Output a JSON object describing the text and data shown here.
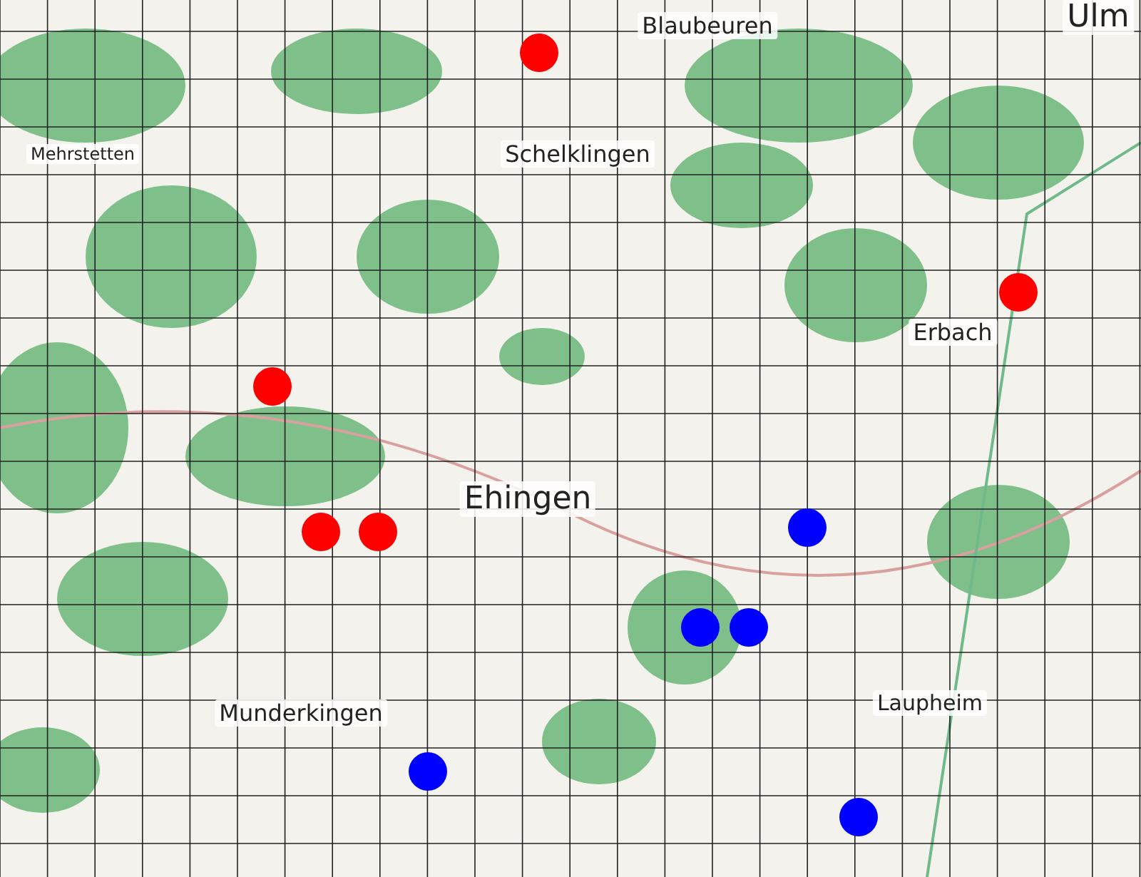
{
  "map": {
    "places": [
      {
        "name": "Blaubeuren"
      },
      {
        "name": "Ulm"
      },
      {
        "name": "Mehrstetten"
      },
      {
        "name": "Schelklingen"
      },
      {
        "name": "Erbach"
      },
      {
        "name": "Ehingen"
      },
      {
        "name": "Laupheim"
      },
      {
        "name": "Munderkingen"
      }
    ],
    "markers": [
      {
        "color": "#ff0000"
      },
      {
        "color": "#ff0000"
      },
      {
        "color": "#ff0000"
      },
      {
        "color": "#ff0000"
      },
      {
        "color": "#ff0000"
      },
      {
        "color": "#0000ff"
      },
      {
        "color": "#0000ff"
      },
      {
        "color": "#0000ff"
      },
      {
        "color": "#0000ff"
      },
      {
        "color": "#0000ff"
      }
    ]
  }
}
